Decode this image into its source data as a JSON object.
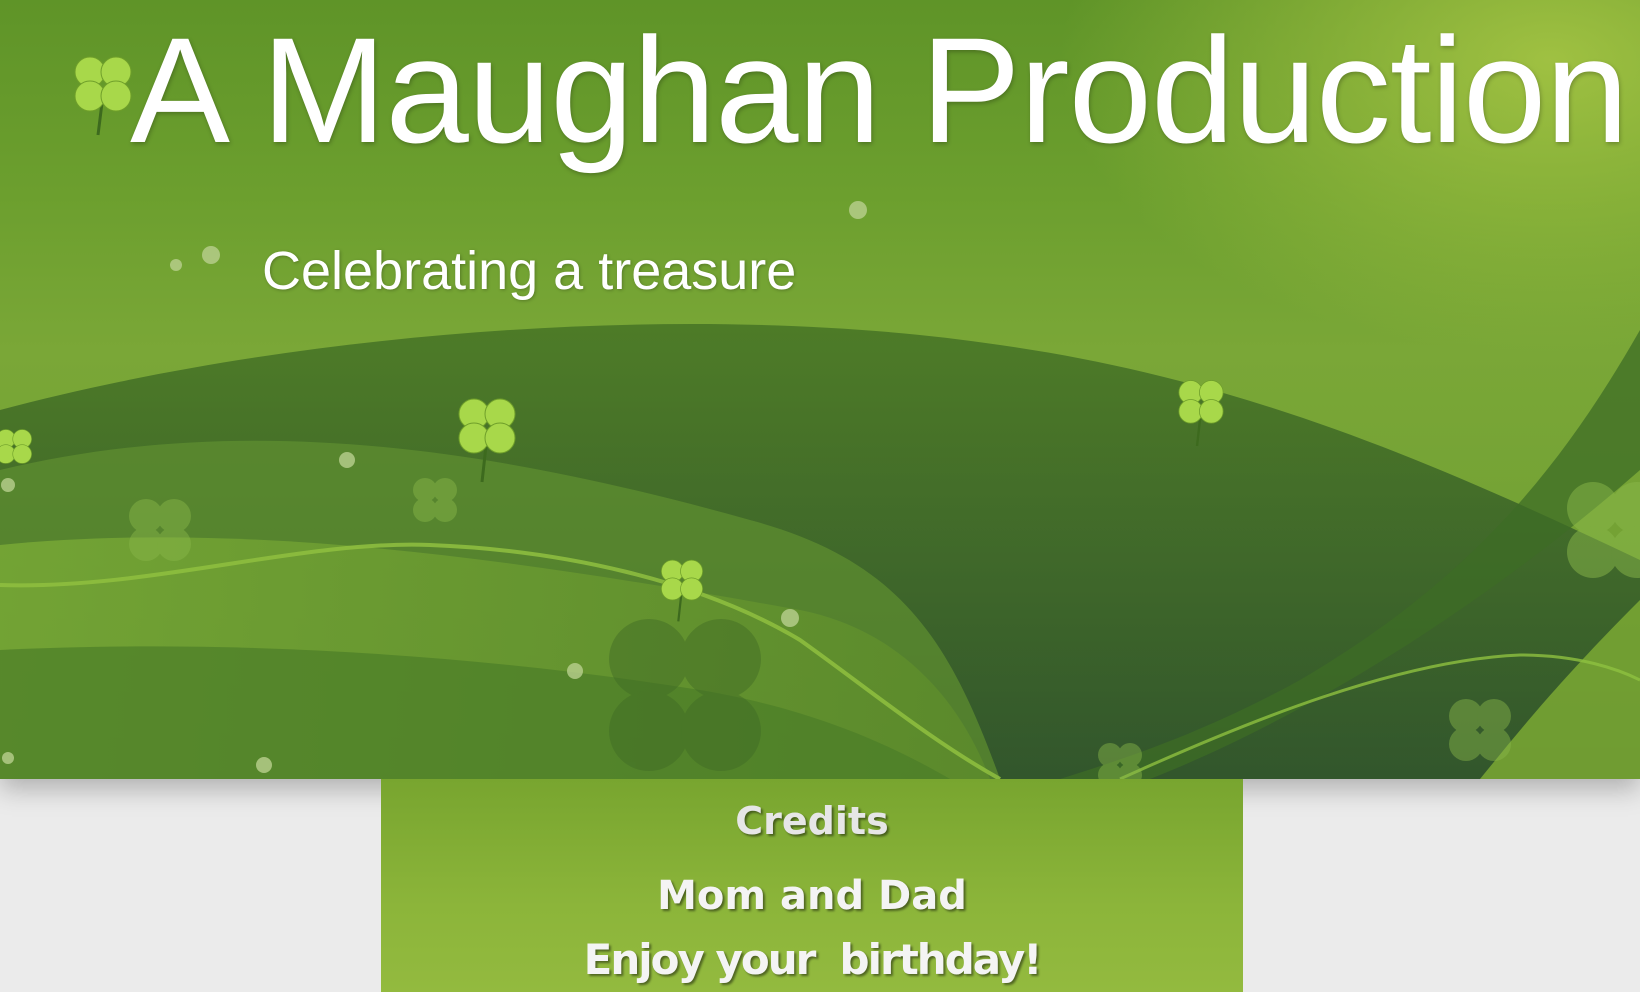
{
  "slide": {
    "title": "A Maughan Production",
    "subtitle": "Celebrating a treasure"
  },
  "credits": {
    "heading": "Credits",
    "names": "Mom and Dad",
    "message": "Enjoy your  birthday!"
  },
  "colors": {
    "background_green": "#6c9f2e",
    "wave_dark": "#2e5a1e",
    "clover_light": "#a8d84a",
    "page_gray": "#ebebeb"
  },
  "icons": [
    "shamrock-icon"
  ]
}
